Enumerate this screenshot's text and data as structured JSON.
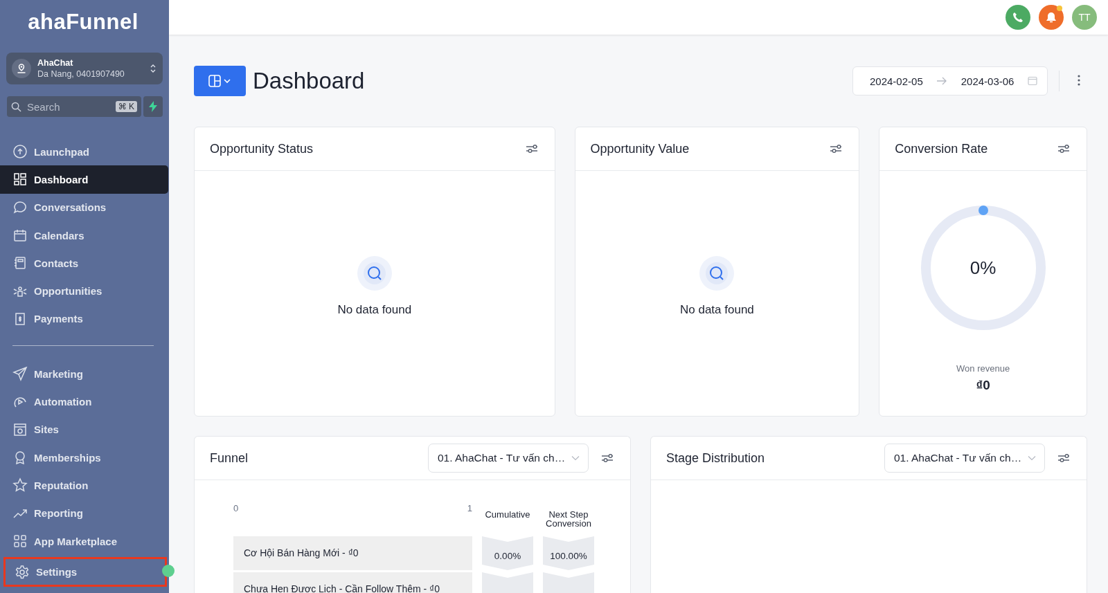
{
  "logo": "ahaFunnel",
  "account": {
    "name": "AhaChat",
    "subtitle": "Da Nang, 0401907490"
  },
  "search": {
    "placeholder": "Search",
    "shortcut": "⌘ K"
  },
  "nav": [
    {
      "label": "Launchpad",
      "selected": false
    },
    {
      "label": "Dashboard",
      "selected": true
    },
    {
      "label": "Conversations",
      "selected": false
    },
    {
      "label": "Calendars",
      "selected": false
    },
    {
      "label": "Contacts",
      "selected": false
    },
    {
      "label": "Opportunities",
      "selected": false
    },
    {
      "label": "Payments",
      "selected": false
    }
  ],
  "nav_secondary": [
    {
      "label": "Marketing",
      "selected": false
    },
    {
      "label": "Automation",
      "selected": false
    },
    {
      "label": "Sites",
      "selected": false
    },
    {
      "label": "Memberships",
      "selected": false
    },
    {
      "label": "Reputation",
      "selected": false
    },
    {
      "label": "Reporting",
      "selected": false
    },
    {
      "label": "App Marketplace",
      "selected": false
    }
  ],
  "settings": {
    "label": "Settings",
    "selected": false,
    "highlighted": true
  },
  "header": {
    "avatar": "TT",
    "notification_dot": true
  },
  "page": {
    "title": "Dashboard",
    "date_from": "2024-02-05",
    "date_to": "2024-03-06"
  },
  "cards": [
    {
      "title": "Opportunity Status",
      "kind": "empty",
      "message": "No data found"
    },
    {
      "title": "Opportunity Value",
      "kind": "empty",
      "message": "No data found"
    },
    {
      "title": "Conversion Rate",
      "kind": "gauge",
      "value": "0%",
      "caption": "Won revenue",
      "amount": "₫0"
    }
  ],
  "funnel": {
    "title": "Funnel",
    "pipeline": "01. AhaChat - Tư vấn ch…",
    "axis": [
      "0",
      "1"
    ],
    "columns": [
      "Cumulative",
      "Next Step Conversion"
    ],
    "rows": [
      {
        "label": "Cơ Hội Bán Hàng Mới - ₫0",
        "cumulative": "0.00%",
        "next_step": "100.00%"
      },
      {
        "label": "Chưa Hẹn Được Lịch - Cần Follow Thêm - ₫0"
      }
    ]
  },
  "stage_distribution": {
    "title": "Stage Distribution",
    "pipeline": "01. AhaChat - Tư vấn ch…"
  }
}
